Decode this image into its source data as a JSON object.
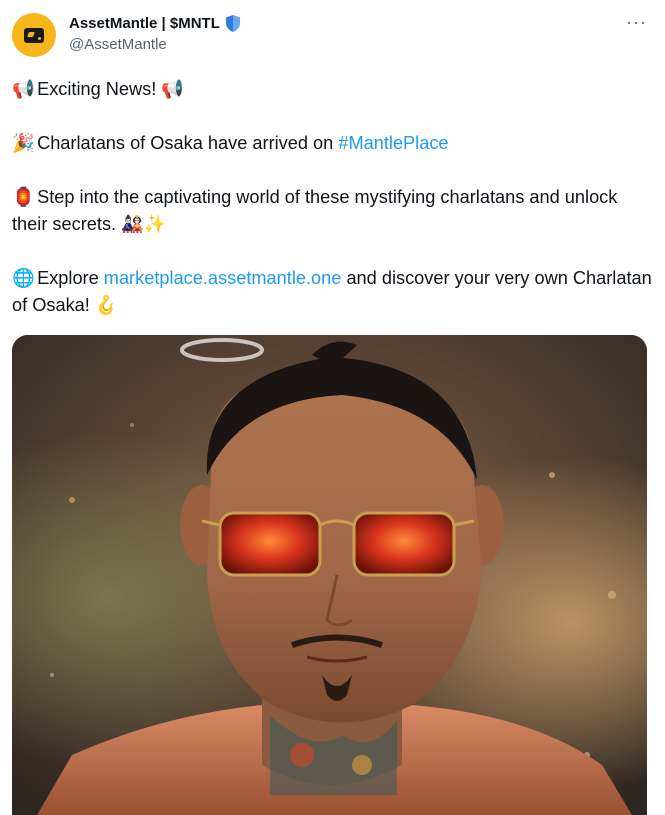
{
  "author": {
    "display_name": "AssetMantle | $MNTL",
    "handle": "@AssetMantle",
    "verified_icon": "verified-shield-icon"
  },
  "menu": {
    "label": "···",
    "icon": "more-options-icon"
  },
  "tweet": {
    "line1": {
      "emoji_a": "📢",
      "text": "Exciting News!",
      "emoji_b": "📢"
    },
    "line2": {
      "emoji": "🎉",
      "text": "Charlatans of Osaka have arrived on",
      "hashtag": "#MantlePlace"
    },
    "line3": {
      "emoji": "🏮",
      "text": "Step into the captivating world of these mystifying charlatans and unlock their secrets.",
      "emoji_b": "🎎✨"
    },
    "line4": {
      "emoji": "🌐",
      "text_before": "Explore",
      "link": "marketplace.assetmantle.one",
      "text_after": "and discover your very own Charlatan of Osaka!",
      "emoji_b": "🪝"
    }
  },
  "colors": {
    "link": "#1d9bf0",
    "brand": "#f7b51c",
    "verified": "#2f7de1"
  }
}
